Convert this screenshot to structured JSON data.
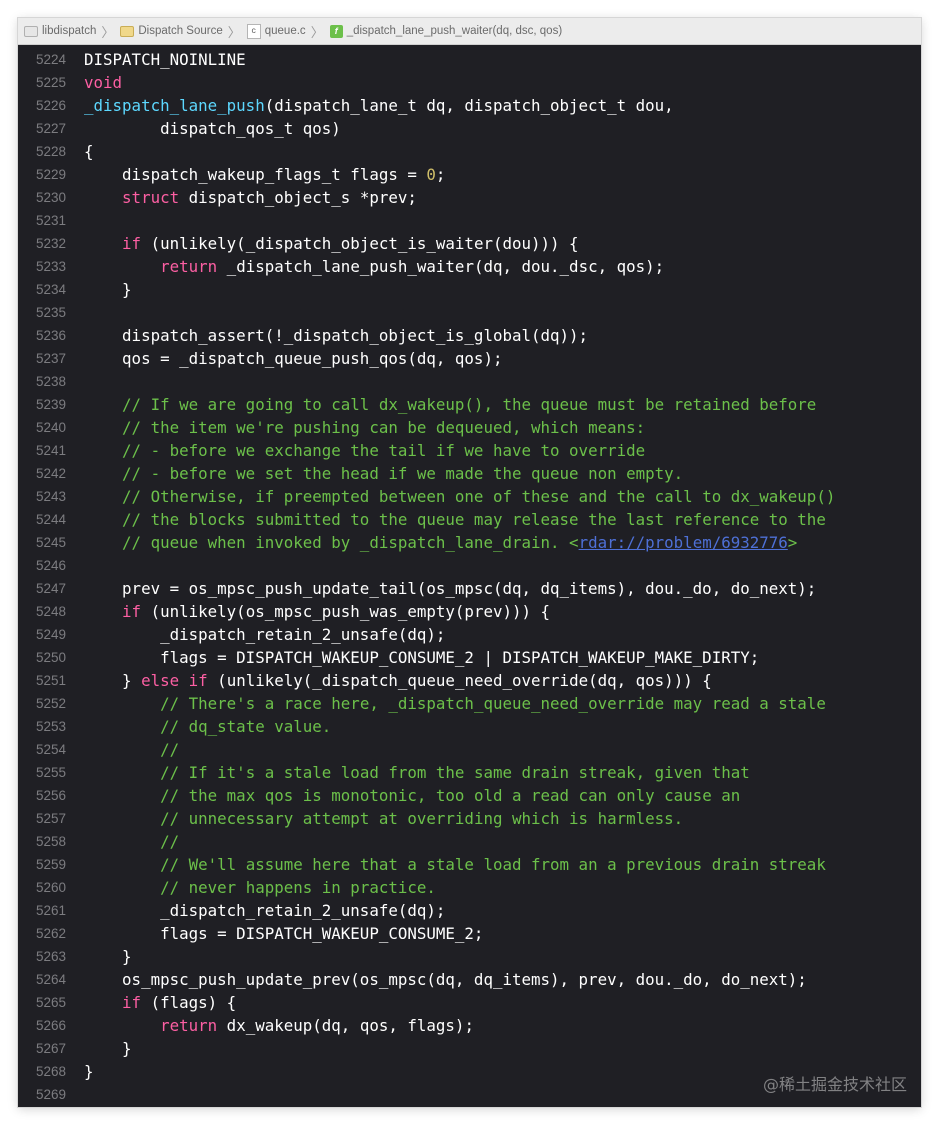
{
  "breadcrumbs": [
    "libdispatch",
    "Dispatch Source",
    "queue.c",
    "_dispatch_lane_push_waiter(dq, dsc, qos)"
  ],
  "watermark": "@稀土掘金技术社区",
  "colors": {
    "background": "#1f1f24",
    "keyword": "#fc5fa3",
    "function_decl": "#5dd8ff",
    "number": "#d0bf69",
    "comment": "#6cc04a",
    "link": "#4e70d6",
    "plain": "#ffffff",
    "line_number": "#7c7c80"
  },
  "lines": [
    {
      "num": "5224",
      "segments": [
        {
          "t": "DISPATCH_NOINLINE",
          "k": "plain"
        }
      ]
    },
    {
      "num": "5225",
      "segments": [
        {
          "t": "void",
          "k": "kw"
        }
      ]
    },
    {
      "num": "5226",
      "segments": [
        {
          "t": "_dispatch_lane_push",
          "k": "fn"
        },
        {
          "t": "(dispatch_lane_t dq, dispatch_object_t dou,",
          "k": "plain"
        }
      ]
    },
    {
      "num": "5227",
      "segments": [
        {
          "t": "        dispatch_qos_t qos)",
          "k": "plain"
        }
      ]
    },
    {
      "num": "5228",
      "segments": [
        {
          "t": "{",
          "k": "plain"
        }
      ]
    },
    {
      "num": "5229",
      "segments": [
        {
          "t": "    dispatch_wakeup_flags_t flags = ",
          "k": "plain"
        },
        {
          "t": "0",
          "k": "num"
        },
        {
          "t": ";",
          "k": "plain"
        }
      ]
    },
    {
      "num": "5230",
      "segments": [
        {
          "t": "    ",
          "k": "plain"
        },
        {
          "t": "struct",
          "k": "kw"
        },
        {
          "t": " dispatch_object_s *prev;",
          "k": "plain"
        }
      ]
    },
    {
      "num": "5231",
      "segments": []
    },
    {
      "num": "5232",
      "segments": [
        {
          "t": "    ",
          "k": "plain"
        },
        {
          "t": "if",
          "k": "kw"
        },
        {
          "t": " (unlikely(_dispatch_object_is_waiter(dou))) {",
          "k": "plain"
        }
      ]
    },
    {
      "num": "5233",
      "segments": [
        {
          "t": "        ",
          "k": "plain"
        },
        {
          "t": "return",
          "k": "kw"
        },
        {
          "t": " _dispatch_lane_push_waiter(dq, dou._dsc, qos);",
          "k": "plain"
        }
      ]
    },
    {
      "num": "5234",
      "segments": [
        {
          "t": "    }",
          "k": "plain"
        }
      ]
    },
    {
      "num": "5235",
      "segments": []
    },
    {
      "num": "5236",
      "segments": [
        {
          "t": "    dispatch_assert(!_dispatch_object_is_global(dq));",
          "k": "plain"
        }
      ]
    },
    {
      "num": "5237",
      "segments": [
        {
          "t": "    qos = _dispatch_queue_push_qos(dq, qos);",
          "k": "plain"
        }
      ]
    },
    {
      "num": "5238",
      "segments": []
    },
    {
      "num": "5239",
      "segments": [
        {
          "t": "    ",
          "k": "plain"
        },
        {
          "t": "// If we are going to call dx_wakeup(), the queue must be retained before",
          "k": "cm"
        }
      ]
    },
    {
      "num": "5240",
      "segments": [
        {
          "t": "    ",
          "k": "plain"
        },
        {
          "t": "// the item we're pushing can be dequeued, which means:",
          "k": "cm"
        }
      ]
    },
    {
      "num": "5241",
      "segments": [
        {
          "t": "    ",
          "k": "plain"
        },
        {
          "t": "// - before we exchange the tail if we have to override",
          "k": "cm"
        }
      ]
    },
    {
      "num": "5242",
      "segments": [
        {
          "t": "    ",
          "k": "plain"
        },
        {
          "t": "// - before we set the head if we made the queue non empty.",
          "k": "cm"
        }
      ]
    },
    {
      "num": "5243",
      "segments": [
        {
          "t": "    ",
          "k": "plain"
        },
        {
          "t": "// Otherwise, if preempted between one of these and the call to dx_wakeup()",
          "k": "cm"
        }
      ]
    },
    {
      "num": "5244",
      "segments": [
        {
          "t": "    ",
          "k": "plain"
        },
        {
          "t": "// the blocks submitted to the queue may release the last reference to the",
          "k": "cm"
        }
      ]
    },
    {
      "num": "5245",
      "segments": [
        {
          "t": "    ",
          "k": "plain"
        },
        {
          "t": "// queue when invoked by _dispatch_lane_drain. <",
          "k": "cm"
        },
        {
          "t": "rdar://problem/6932776",
          "k": "link"
        },
        {
          "t": ">",
          "k": "cm"
        }
      ]
    },
    {
      "num": "5246",
      "segments": []
    },
    {
      "num": "5247",
      "segments": [
        {
          "t": "    prev = os_mpsc_push_update_tail(os_mpsc(dq, dq_items), dou._do, do_next);",
          "k": "plain"
        }
      ]
    },
    {
      "num": "5248",
      "segments": [
        {
          "t": "    ",
          "k": "plain"
        },
        {
          "t": "if",
          "k": "kw"
        },
        {
          "t": " (unlikely(os_mpsc_push_was_empty(prev))) {",
          "k": "plain"
        }
      ]
    },
    {
      "num": "5249",
      "segments": [
        {
          "t": "        _dispatch_retain_2_unsafe(dq);",
          "k": "plain"
        }
      ]
    },
    {
      "num": "5250",
      "segments": [
        {
          "t": "        flags = DISPATCH_WAKEUP_CONSUME_2 | DISPATCH_WAKEUP_MAKE_DIRTY;",
          "k": "plain"
        }
      ]
    },
    {
      "num": "5251",
      "segments": [
        {
          "t": "    } ",
          "k": "plain"
        },
        {
          "t": "else",
          "k": "kw"
        },
        {
          "t": " ",
          "k": "plain"
        },
        {
          "t": "if",
          "k": "kw"
        },
        {
          "t": " (unlikely(_dispatch_queue_need_override(dq, qos))) {",
          "k": "plain"
        }
      ]
    },
    {
      "num": "5252",
      "segments": [
        {
          "t": "        ",
          "k": "plain"
        },
        {
          "t": "// There's a race here, _dispatch_queue_need_override may read a stale",
          "k": "cm"
        }
      ]
    },
    {
      "num": "5253",
      "segments": [
        {
          "t": "        ",
          "k": "plain"
        },
        {
          "t": "// dq_state value.",
          "k": "cm"
        }
      ]
    },
    {
      "num": "5254",
      "segments": [
        {
          "t": "        ",
          "k": "plain"
        },
        {
          "t": "//",
          "k": "cm"
        }
      ]
    },
    {
      "num": "5255",
      "segments": [
        {
          "t": "        ",
          "k": "plain"
        },
        {
          "t": "// If it's a stale load from the same drain streak, given that",
          "k": "cm"
        }
      ]
    },
    {
      "num": "5256",
      "segments": [
        {
          "t": "        ",
          "k": "plain"
        },
        {
          "t": "// the max qos is monotonic, too old a read can only cause an",
          "k": "cm"
        }
      ]
    },
    {
      "num": "5257",
      "segments": [
        {
          "t": "        ",
          "k": "plain"
        },
        {
          "t": "// unnecessary attempt at overriding which is harmless.",
          "k": "cm"
        }
      ]
    },
    {
      "num": "5258",
      "segments": [
        {
          "t": "        ",
          "k": "plain"
        },
        {
          "t": "//",
          "k": "cm"
        }
      ]
    },
    {
      "num": "5259",
      "segments": [
        {
          "t": "        ",
          "k": "plain"
        },
        {
          "t": "// We'll assume here that a stale load from an a previous drain streak",
          "k": "cm"
        }
      ]
    },
    {
      "num": "5260",
      "segments": [
        {
          "t": "        ",
          "k": "plain"
        },
        {
          "t": "// never happens in practice.",
          "k": "cm"
        }
      ]
    },
    {
      "num": "5261",
      "segments": [
        {
          "t": "        _dispatch_retain_2_unsafe(dq);",
          "k": "plain"
        }
      ]
    },
    {
      "num": "5262",
      "segments": [
        {
          "t": "        flags = DISPATCH_WAKEUP_CONSUME_2;",
          "k": "plain"
        }
      ]
    },
    {
      "num": "5263",
      "segments": [
        {
          "t": "    }",
          "k": "plain"
        }
      ]
    },
    {
      "num": "5264",
      "segments": [
        {
          "t": "    os_mpsc_push_update_prev(os_mpsc(dq, dq_items), prev, dou._do, do_next);",
          "k": "plain"
        }
      ]
    },
    {
      "num": "5265",
      "segments": [
        {
          "t": "    ",
          "k": "plain"
        },
        {
          "t": "if",
          "k": "kw"
        },
        {
          "t": " (flags) {",
          "k": "plain"
        }
      ]
    },
    {
      "num": "5266",
      "segments": [
        {
          "t": "        ",
          "k": "plain"
        },
        {
          "t": "return",
          "k": "kw"
        },
        {
          "t": " dx_wakeup(dq, qos, flags);",
          "k": "plain"
        }
      ]
    },
    {
      "num": "5267",
      "segments": [
        {
          "t": "    }",
          "k": "plain"
        }
      ]
    },
    {
      "num": "5268",
      "segments": [
        {
          "t": "}",
          "k": "plain"
        }
      ]
    },
    {
      "num": "5269",
      "segments": []
    }
  ]
}
